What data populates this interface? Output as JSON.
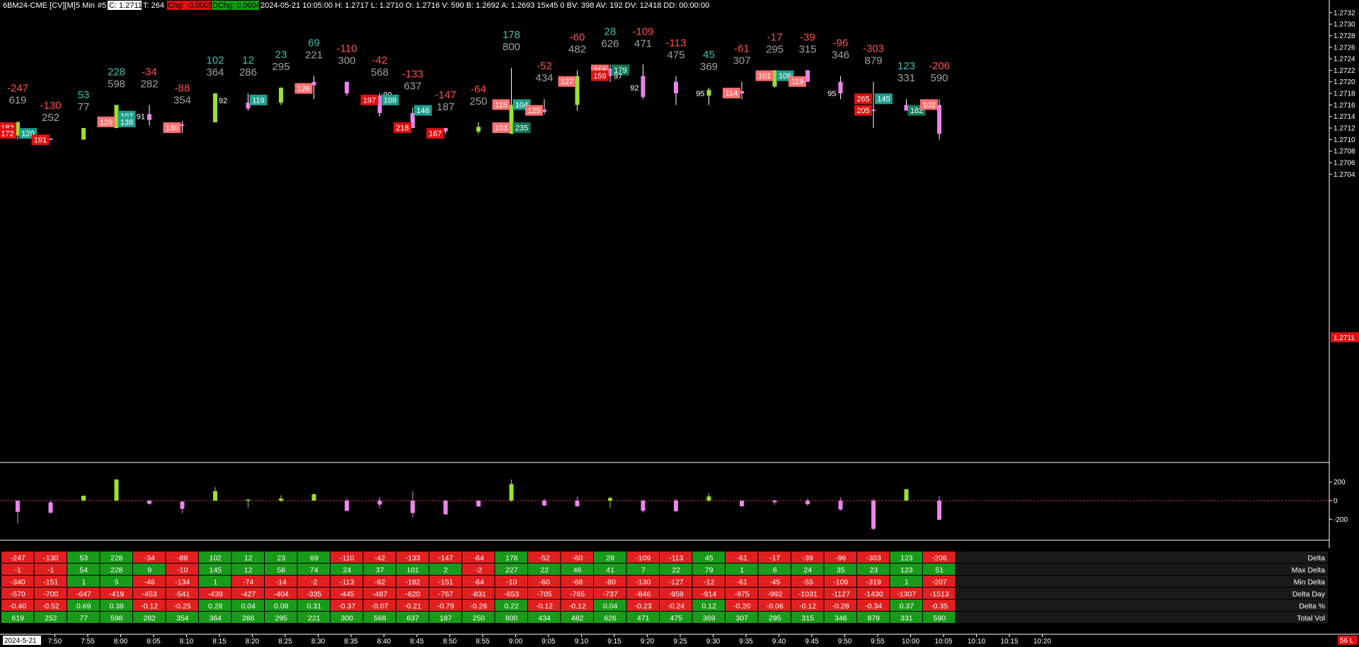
{
  "header": {
    "symbol": "6BM24-CME [CV][M]",
    "period": "5 Min",
    "study": "#5",
    "close": "C: 1.2711",
    "trades": "T: 264",
    "chg": "Chg: -0.0005",
    "dchg": "DChg: 0.0004",
    "details": "2024-05-21 10:05:00 H: 1.2717 L: 1.2710 O: 1.2716 V: 590 B: 1.2692 A: 1.2693 15x45 0 BV: 398 AV: 192 DV: 12418 DD: 00:00:00"
  },
  "price_axis": {
    "ticks": [
      "1.2732",
      "1.2730",
      "1.2728",
      "1.2726",
      "1.2724",
      "1.2722",
      "1.2720",
      "1.2718",
      "1.2716",
      "1.2714",
      "1.2712",
      "1.2710",
      "1.2708",
      "1.2706",
      "1.2704"
    ],
    "last_price": "1.2711"
  },
  "delta_axis": {
    "ticks": [
      "200",
      "0",
      "-200"
    ]
  },
  "time_axis": {
    "date_label": "2024-5-21",
    "labels": [
      "7:50",
      "7:55",
      "8:00",
      "8:05",
      "8:10",
      "8:15",
      "8:20",
      "8:25",
      "8:30",
      "8:35",
      "8:40",
      "8:45",
      "8:50",
      "8:55",
      "9:00",
      "9:05",
      "9:10",
      "9:15",
      "9:20",
      "9:25",
      "9:30",
      "9:35",
      "9:40",
      "9:45",
      "9:50",
      "9:55",
      "10:00",
      "10:05",
      "10:10",
      "10:15",
      "10:20"
    ]
  },
  "status": {
    "corner": "56 L"
  },
  "colors": {
    "up_candle": "#9be22d",
    "down_candle": "#ee82ee",
    "pos_text": "#3cc0b0",
    "neg_text": "#ff5050",
    "vol_text": "#a0a0a0",
    "table_pos": "#1a9a1a",
    "table_neg": "#e02020",
    "bid_box": "#ff7070",
    "ask_box": "#20a090"
  },
  "chart_data": {
    "type": "candlestick",
    "interval": "5 Min",
    "x": [
      "7:45",
      "7:50",
      "7:55",
      "8:00",
      "8:05",
      "8:10",
      "8:15",
      "8:20",
      "8:25",
      "8:30",
      "8:35",
      "8:40",
      "8:45",
      "8:50",
      "8:55",
      "9:00",
      "9:05",
      "9:10",
      "9:15",
      "9:20",
      "9:25",
      "9:30",
      "9:35",
      "9:40",
      "9:45",
      "9:50",
      "9:55",
      "10:00",
      "10:05"
    ],
    "open": [
      1.27107,
      1.27102,
      1.271,
      1.2712,
      1.27144,
      1.27126,
      1.2713,
      1.27164,
      1.27164,
      1.272,
      1.272,
      1.27176,
      1.27146,
      1.2712,
      1.27114,
      1.2711,
      1.27152,
      1.2716,
      1.27223,
      1.2721,
      1.272,
      1.27176,
      1.27184,
      1.27192,
      1.2722,
      1.272,
      1.27152,
      1.2716,
      1.2716
    ],
    "high": [
      1.27132,
      1.27102,
      1.2712,
      1.2716,
      1.2716,
      1.27132,
      1.2718,
      1.2718,
      1.2719,
      1.2721,
      1.272,
      1.2718,
      1.27156,
      1.2712,
      1.2713,
      1.27224,
      1.2717,
      1.2722,
      1.2723,
      1.2723,
      1.2721,
      1.2719,
      1.272,
      1.2722,
      1.2722,
      1.2721,
      1.272,
      1.2717,
      1.2717
    ],
    "low": [
      1.271,
      1.271,
      1.271,
      1.2712,
      1.27124,
      1.27112,
      1.2713,
      1.2715,
      1.2716,
      1.2717,
      1.27176,
      1.2714,
      1.2712,
      1.2711,
      1.2711,
      1.2711,
      1.27144,
      1.2715,
      1.272,
      1.2717,
      1.2716,
      1.2716,
      1.2717,
      1.2719,
      1.272,
      1.2717,
      1.2712,
      1.2715,
      1.271
    ],
    "close": [
      1.2713,
      1.271,
      1.2712,
      1.2716,
      1.27134,
      1.27124,
      1.2718,
      1.27154,
      1.2719,
      1.27194,
      1.2718,
      1.27146,
      1.2712,
      1.27114,
      1.27122,
      1.2716,
      1.27148,
      1.2721,
      1.2721,
      1.27174,
      1.2718,
      1.27186,
      1.2718,
      1.2722,
      1.272,
      1.2718,
      1.2715,
      1.2715,
      1.2711
    ],
    "delta_annotation": [
      "-247",
      "-130",
      "53",
      "228",
      "-34",
      "-88",
      "102",
      "12",
      "23",
      "69",
      "-110",
      "-42",
      "-133",
      "-147",
      "-64",
      "178",
      "-52",
      "-60",
      "28",
      "-109",
      "-113",
      "45",
      "-61",
      "-17",
      "-39",
      "-96",
      "-303",
      "123",
      "-206"
    ],
    "volume_annotation": [
      "619",
      "252",
      "77",
      "598",
      "282",
      "354",
      "364",
      "286",
      "295",
      "221",
      "300",
      "568",
      "637",
      "187",
      "250",
      "800",
      "434",
      "482",
      "626",
      "471",
      "475",
      "369",
      "307",
      "295",
      "315",
      "346",
      "879",
      "331",
      "590"
    ],
    "order_labels": [
      {
        "bar": 0,
        "price": 1.2712,
        "text": "182",
        "kind": "bid_dark"
      },
      {
        "bar": 0,
        "price": 1.2711,
        "text": "172",
        "kind": "bid_dark"
      },
      {
        "bar": 0,
        "price": 1.2711,
        "text": "120",
        "kind": "ask"
      },
      {
        "bar": 1,
        "price": 1.27099,
        "text": "191",
        "kind": "bid_dark"
      },
      {
        "bar": 3,
        "price": 1.2714,
        "text": "107",
        "kind": "ask"
      },
      {
        "bar": 3,
        "price": 1.2713,
        "text": "129",
        "kind": "bid"
      },
      {
        "bar": 3,
        "price": 1.2713,
        "text": "138",
        "kind": "ask"
      },
      {
        "bar": 4,
        "price": 1.2714,
        "text": "91",
        "kind": "plain_left"
      },
      {
        "bar": 5,
        "price": 1.2712,
        "text": "130",
        "kind": "bid"
      },
      {
        "bar": 6,
        "price": 1.27168,
        "text": "92",
        "kind": "plain_right"
      },
      {
        "bar": 7,
        "price": 1.27168,
        "text": "119",
        "kind": "ask"
      },
      {
        "bar": 9,
        "price": 1.27188,
        "text": "126",
        "kind": "bid"
      },
      {
        "bar": 11,
        "price": 1.27178,
        "text": "90",
        "kind": "plain_right"
      },
      {
        "bar": 11,
        "price": 1.27168,
        "text": "197",
        "kind": "bid_dark"
      },
      {
        "bar": 11,
        "price": 1.27168,
        "text": "109",
        "kind": "ask"
      },
      {
        "bar": 12,
        "price": 1.2715,
        "text": "146",
        "kind": "ask"
      },
      {
        "bar": 12,
        "price": 1.2712,
        "text": "218",
        "kind": "bid_dark"
      },
      {
        "bar": 13,
        "price": 1.2711,
        "text": "167",
        "kind": "bid_dark"
      },
      {
        "bar": 15,
        "price": 1.2716,
        "text": "115",
        "kind": "bid"
      },
      {
        "bar": 15,
        "price": 1.2716,
        "text": "104",
        "kind": "ask"
      },
      {
        "bar": 15,
        "price": 1.2712,
        "text": "103",
        "kind": "bid"
      },
      {
        "bar": 15,
        "price": 1.2712,
        "text": "235",
        "kind": "ask_dark"
      },
      {
        "bar": 16,
        "price": 1.2715,
        "text": "129",
        "kind": "bid"
      },
      {
        "bar": 17,
        "price": 1.272,
        "text": "127",
        "kind": "bid"
      },
      {
        "bar": 18,
        "price": 1.2722,
        "text": "114",
        "kind": "bid"
      },
      {
        "bar": 18,
        "price": 1.2722,
        "text": "179",
        "kind": "ask_dark"
      },
      {
        "bar": 18,
        "price": 1.2721,
        "text": "159",
        "kind": "bid_dark"
      },
      {
        "bar": 18,
        "price": 1.2721,
        "text": "97",
        "kind": "plain_right"
      },
      {
        "bar": 19,
        "price": 1.2719,
        "text": "92",
        "kind": "plain_left"
      },
      {
        "bar": 21,
        "price": 1.2718,
        "text": "95",
        "kind": "plain_left"
      },
      {
        "bar": 22,
        "price": 1.2718,
        "text": "114",
        "kind": "bid"
      },
      {
        "bar": 23,
        "price": 1.2721,
        "text": "101",
        "kind": "bid"
      },
      {
        "bar": 23,
        "price": 1.2721,
        "text": "106",
        "kind": "ask"
      },
      {
        "bar": 24,
        "price": 1.272,
        "text": "119",
        "kind": "bid"
      },
      {
        "bar": 25,
        "price": 1.2718,
        "text": "95",
        "kind": "plain_left"
      },
      {
        "bar": 26,
        "price": 1.2717,
        "text": "265",
        "kind": "bid_dark"
      },
      {
        "bar": 26,
        "price": 1.2717,
        "text": "145",
        "kind": "ask"
      },
      {
        "bar": 26,
        "price": 1.2715,
        "text": "205",
        "kind": "bid_dark"
      },
      {
        "bar": 27,
        "price": 1.2715,
        "text": "182",
        "kind": "ask_dark"
      },
      {
        "bar": 28,
        "price": 1.2716,
        "text": "102",
        "kind": "bid"
      }
    ],
    "delta_histogram": {
      "ylim": [
        -310,
        230
      ],
      "bars": [
        {
          "x": "7:45",
          "open": 0,
          "close": -120,
          "low": -247,
          "high": 0
        },
        {
          "x": "7:50",
          "open": -20,
          "close": -130,
          "low": -140,
          "high": 0
        },
        {
          "x": "7:55",
          "open": 0,
          "close": 53,
          "low": 0,
          "high": 54
        },
        {
          "x": "8:00",
          "open": 0,
          "close": 228,
          "low": 0,
          "high": 228
        },
        {
          "x": "8:05",
          "open": 0,
          "close": -34,
          "low": -46,
          "high": 9
        },
        {
          "x": "8:10",
          "open": -10,
          "close": -88,
          "low": -134,
          "high": -10
        },
        {
          "x": "8:15",
          "open": 0,
          "close": 102,
          "low": 1,
          "high": 145
        },
        {
          "x": "8:20",
          "open": 0,
          "close": 12,
          "low": -74,
          "high": 12
        },
        {
          "x": "8:25",
          "open": 0,
          "close": 23,
          "low": -14,
          "high": 58
        },
        {
          "x": "8:30",
          "open": 0,
          "close": 69,
          "low": -2,
          "high": 74
        },
        {
          "x": "8:35",
          "open": 0,
          "close": -110,
          "low": -113,
          "high": 24
        },
        {
          "x": "8:40",
          "open": 0,
          "close": -42,
          "low": -82,
          "high": 37
        },
        {
          "x": "8:45",
          "open": 0,
          "close": -133,
          "low": -182,
          "high": 101
        },
        {
          "x": "8:50",
          "open": 0,
          "close": -147,
          "low": -151,
          "high": 2
        },
        {
          "x": "8:55",
          "open": 0,
          "close": -64,
          "low": -64,
          "high": -2
        },
        {
          "x": "9:00",
          "open": 0,
          "close": 178,
          "low": -10,
          "high": 227
        },
        {
          "x": "9:05",
          "open": 0,
          "close": -52,
          "low": -60,
          "high": 22
        },
        {
          "x": "9:10",
          "open": 0,
          "close": -60,
          "low": -68,
          "high": 46
        },
        {
          "x": "9:15",
          "open": 0,
          "close": 28,
          "low": -80,
          "high": 41
        },
        {
          "x": "9:20",
          "open": 0,
          "close": -109,
          "low": -130,
          "high": 7
        },
        {
          "x": "9:25",
          "open": 0,
          "close": -113,
          "low": -127,
          "high": 22
        },
        {
          "x": "9:30",
          "open": 0,
          "close": 45,
          "low": -12,
          "high": 79
        },
        {
          "x": "9:35",
          "open": 0,
          "close": -61,
          "low": -61,
          "high": 1
        },
        {
          "x": "9:40",
          "open": 0,
          "close": -17,
          "low": -45,
          "high": 6
        },
        {
          "x": "9:45",
          "open": 0,
          "close": -39,
          "low": -55,
          "high": 24
        },
        {
          "x": "9:50",
          "open": 0,
          "close": -96,
          "low": -109,
          "high": 35
        },
        {
          "x": "9:55",
          "open": 0,
          "close": -303,
          "low": -319,
          "high": 23
        },
        {
          "x": "10:00",
          "open": 0,
          "close": 123,
          "low": 1,
          "high": 123
        },
        {
          "x": "10:05",
          "open": 0,
          "close": -206,
          "low": -207,
          "high": 51
        }
      ]
    },
    "table": {
      "row_labels": [
        "Delta",
        "Max Delta",
        "Min Delta",
        "Delta Day",
        "Delta %",
        "Total Vol"
      ],
      "rows": [
        [
          "-247",
          "-130",
          "53",
          "228",
          "-34",
          "-88",
          "102",
          "12",
          "23",
          "69",
          "-110",
          "-42",
          "-133",
          "-147",
          "-64",
          "178",
          "-52",
          "-60",
          "28",
          "-109",
          "-113",
          "45",
          "-61",
          "-17",
          "-39",
          "-96",
          "-303",
          "123",
          "-206"
        ],
        [
          "-1",
          "-1",
          "54",
          "228",
          "9",
          "-10",
          "145",
          "12",
          "58",
          "74",
          "24",
          "37",
          "101",
          "2",
          "-2",
          "227",
          "22",
          "46",
          "41",
          "7",
          "22",
          "79",
          "1",
          "6",
          "24",
          "35",
          "23",
          "123",
          "51"
        ],
        [
          "-340",
          "-151",
          "1",
          "5",
          "-46",
          "-134",
          "1",
          "-74",
          "-14",
          "-2",
          "-113",
          "-82",
          "-182",
          "-151",
          "-64",
          "-10",
          "-60",
          "-68",
          "-80",
          "-130",
          "-127",
          "-12",
          "-61",
          "-45",
          "-55",
          "-109",
          "-319",
          "1",
          "-207"
        ],
        [
          "-570",
          "-700",
          "-647",
          "-419",
          "-453",
          "-541",
          "-439",
          "-427",
          "-404",
          "-335",
          "-445",
          "-487",
          "-620",
          "-767",
          "-831",
          "-653",
          "-705",
          "-765",
          "-737",
          "-846",
          "-959",
          "-914",
          "-975",
          "-992",
          "-1031",
          "-1127",
          "-1430",
          "-1307",
          "-1513"
        ],
        [
          "-0.40",
          "-0.52",
          "0.69",
          "0.38",
          "-0.12",
          "-0.25",
          "0.28",
          "0.04",
          "0.08",
          "0.31",
          "-0.37",
          "-0.07",
          "-0.21",
          "-0.79",
          "-0.26",
          "0.22",
          "-0.12",
          "-0.12",
          "0.04",
          "-0.23",
          "-0.24",
          "0.12",
          "-0.20",
          "-0.06",
          "-0.12",
          "-0.28",
          "-0.34",
          "0.37",
          "-0.35"
        ],
        [
          "619",
          "252",
          "77",
          "598",
          "282",
          "354",
          "364",
          "286",
          "295",
          "221",
          "300",
          "568",
          "637",
          "187",
          "250",
          "800",
          "434",
          "482",
          "626",
          "471",
          "475",
          "369",
          "307",
          "295",
          "315",
          "346",
          "879",
          "331",
          "590"
        ]
      ]
    }
  }
}
